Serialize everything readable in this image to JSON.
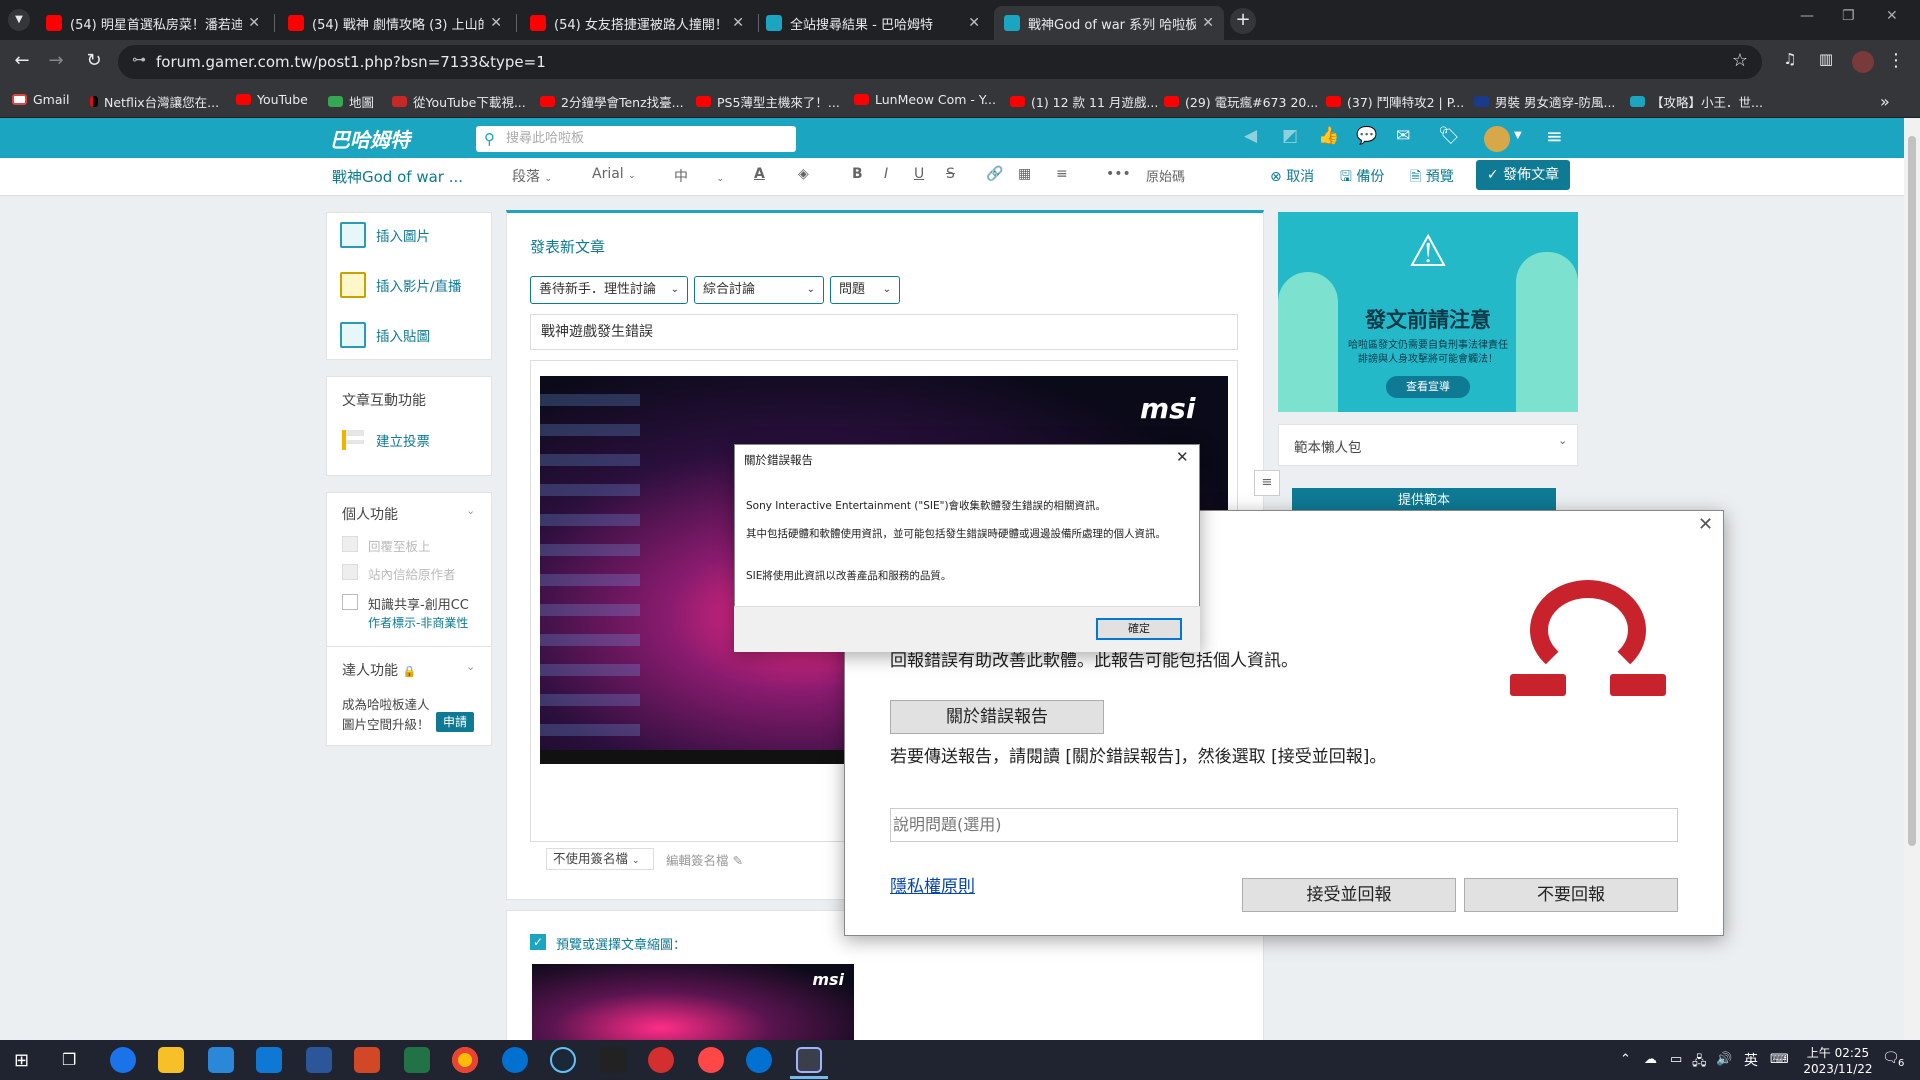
{
  "browser": {
    "tabs": [
      {
        "title": "(54) 明星首選私房菜！潘若迪",
        "icon": "youtube-icon",
        "active": false
      },
      {
        "title": "(54) 戰神 劇情攻略 (3) 上山的路",
        "icon": "youtube-icon",
        "active": false
      },
      {
        "title": "(54) 女友搭捷運被路人撞開！",
        "icon": "youtube-icon",
        "active": false
      },
      {
        "title": "全站搜尋結果 - 巴哈姆特",
        "icon": "bahamut-icon",
        "active": false
      },
      {
        "title": "戰神God of war 系列 哈啦板 -",
        "icon": "bahamut-icon",
        "active": true
      }
    ],
    "url": "forum.gamer.com.tw/post1.php?bsn=7133&type=1",
    "bookmarks": [
      "Gmail",
      "Netflix台灣讓您在...",
      "YouTube",
      "地圖",
      "從YouTube下載視...",
      "2分鐘學會Tenz找臺...",
      "PS5薄型主機來了！...",
      "LunMeow Com - Y...",
      "(1) 12 款 11 月遊戲...",
      "(29) 電玩瘋#673 20...",
      "(37) 鬥陣特攻2 | P...",
      "男裝 男女適穿-防風...",
      "【攻略】小王．世..."
    ]
  },
  "site": {
    "logo": "巴哈姆特",
    "search_placeholder": "搜尋此哈啦板",
    "board_name": "戰神God of war ...",
    "editor": {
      "paragraph": "段落",
      "font": "Arial",
      "size": "中",
      "source": "原始碼",
      "cancel": "取消",
      "backup": "備份",
      "preview": "預覽",
      "publish": "發佈文章"
    }
  },
  "sidebar": {
    "insert": [
      {
        "label": "插入圖片",
        "icon": "image-icon"
      },
      {
        "label": "插入影片/直播",
        "icon": "video-icon"
      },
      {
        "label": "插入貼圖",
        "icon": "sticker-icon"
      }
    ],
    "interaction_title": "文章互動功能",
    "vote": "建立投票",
    "personal_title": "個人功能",
    "opt_reply": "回覆至板上",
    "opt_notify": "站內信給原作者",
    "opt_cc": "知識共享-創用CC",
    "cc_desc": "作者標示-非商業性",
    "expert_title": "達人功能",
    "expert_desc1": "成為哈啦板達人",
    "expert_desc2": "圖片空間升級！",
    "apply": "申請"
  },
  "editor": {
    "heading": "發表新文章",
    "category1": "善待新手．理性討論",
    "category2": "綜合討論",
    "category3": "問題",
    "title_value": "戰神遊戲發生錯誤",
    "signature_select": "不使用簽名檔",
    "signature_edit": "編輯簽名檔",
    "thumbnail_label": "預覽或選擇文章縮圖："
  },
  "right_panel": {
    "notice_title": "發文前請注意",
    "notice_text1": "哈啦區發文仍需要自負刑事法律責任",
    "notice_text2": "誹謗與人身攻擊將可能會觸法！",
    "notice_button": "查看宣導",
    "template_title": "範本懶人包",
    "template_button": "提供範本"
  },
  "about_dialog": {
    "title": "關於錯誤報告",
    "p1": "Sony Interactive Entertainment (\"SIE\")會收集軟體發生錯誤的相關資訊。",
    "p2": "其中包括硬體和軟體使用資訊，並可能包括發生錯誤時硬體或週邊設備所處理的個人資訊。",
    "p3": "SIE將使用此資訊以改善產品和服務的品質。",
    "ok": "確定"
  },
  "crash_dialog": {
    "line1": "回報錯誤有助改善此軟體。此報告可能包括個人資訊。",
    "about_button": "關於錯誤報告",
    "line2": "若要傳送報告，請閱讀 [關於錯誤報告]，然後選取 [接受並回報]。",
    "describe_placeholder": "說明問題(選用)",
    "privacy": "隱私權原則",
    "accept": "接受並回報",
    "decline": "不要回報"
  },
  "taskbar": {
    "ime": "英",
    "time": "上午 02:25",
    "date": "2023/11/22",
    "notifications": "6"
  },
  "colors": {
    "brand": "#1ba5c1",
    "accent_dark": "#0e7a94",
    "warning_red": "#c8232c"
  }
}
